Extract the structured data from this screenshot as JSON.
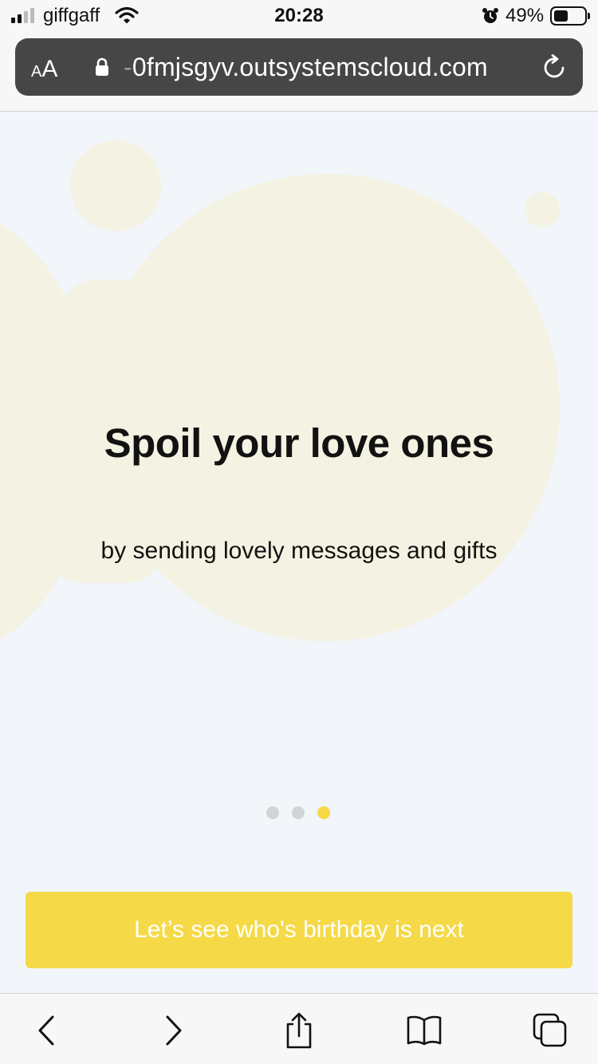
{
  "status_bar": {
    "carrier": "giffgaff",
    "time": "20:28",
    "battery_percent": "49%",
    "signal_bars": 2,
    "icons": [
      "signal-icon",
      "wifi-icon",
      "alarm-icon",
      "battery-icon"
    ]
  },
  "browser": {
    "text_size_label_small": "A",
    "text_size_label_large": "A",
    "url_prefix": "-",
    "url": "0fmjsgyv.outsystemscloud.com",
    "icons": [
      "lock-icon",
      "reload-icon"
    ]
  },
  "onboarding": {
    "title": "Spoil your love ones",
    "subtitle": "by sending lovely messages and gifts",
    "pages_total": 3,
    "active_page": 3,
    "cta_label": "Let’s see who's birthday is next"
  },
  "toolbar": {
    "icons": [
      "back-icon",
      "forward-icon",
      "share-icon",
      "bookmarks-icon",
      "tabs-icon"
    ]
  },
  "colors": {
    "accent": "#f5d947",
    "background": "#f2f5f9",
    "blob": "#f4f2e2",
    "dot_inactive": "#d1d3d6",
    "url_bar": "#464646"
  }
}
